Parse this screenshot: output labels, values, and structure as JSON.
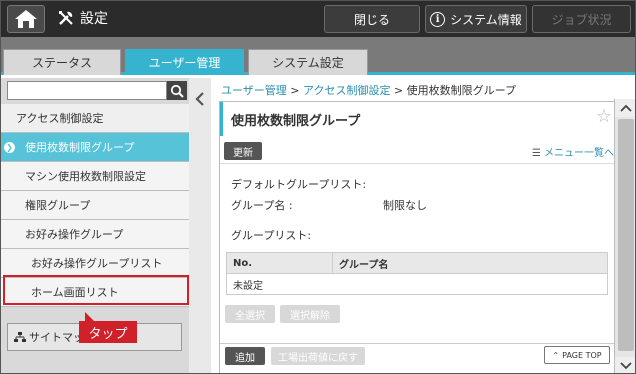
{
  "topbar": {
    "title": "設定",
    "close_label": "閉じる",
    "system_info_label": "システム情報",
    "job_status_label": "ジョブ状況"
  },
  "tabs": [
    {
      "label": "ステータス"
    },
    {
      "label": "ユーザー管理"
    },
    {
      "label": "システム設定"
    }
  ],
  "sidebar": {
    "search_placeholder": "",
    "items": [
      {
        "label": "アクセス制御設定"
      },
      {
        "label": "使用枚数制限グループ"
      },
      {
        "label": "マシン使用枚数制限設定"
      },
      {
        "label": "権限グループ"
      },
      {
        "label": "お好み操作グループ"
      },
      {
        "label": "お好み操作グループリスト"
      },
      {
        "label": "ホーム画面リスト"
      }
    ],
    "sitemap_label": "サイトマップ",
    "callout": "タップ"
  },
  "breadcrumb": {
    "item1": "ユーザー管理",
    "item2": "アクセス制御設定",
    "item3": "使用枚数制限グループ",
    "sep": ">"
  },
  "panel": {
    "title": "使用枚数制限グループ",
    "update_label": "更新",
    "menu_link": "メニュー一覧へ",
    "default_group_list": "デフォルトグループリスト:",
    "group_name_label": "グループ名 :",
    "group_name_value": "制限なし",
    "group_list": "グループリスト:",
    "table": {
      "col_no": "No.",
      "col_group_name": "グループ名",
      "rows": [
        "未設定"
      ]
    },
    "select_all": "全選択",
    "deselect": "選択解除",
    "add_label": "追加",
    "reset_label": "工場出荷値に戻す",
    "page_top": "PAGE TOP"
  },
  "colors": {
    "accent": "#36b4cf",
    "highlight": "#d0202a",
    "topbar": "#2b2b2b"
  }
}
